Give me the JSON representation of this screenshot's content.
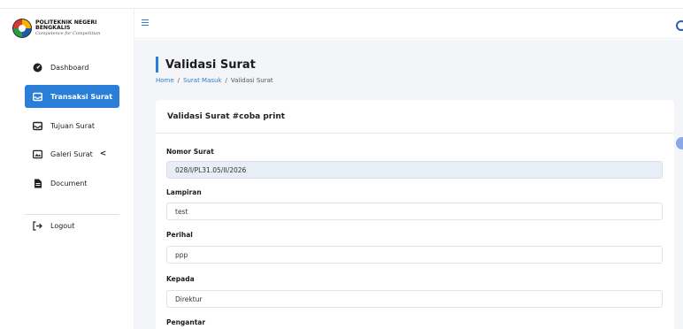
{
  "brand": {
    "title": "POLITEKNIK NEGERI BENGKALIS",
    "subtitle": "Competence for Competition"
  },
  "sidebar": {
    "items": [
      {
        "label": "Dashboard",
        "icon": "dashboard-icon"
      },
      {
        "label": "Transaksi Surat",
        "icon": "envelope-icon",
        "active": true
      },
      {
        "label": "Tujuan Surat",
        "icon": "envelope-icon"
      },
      {
        "label": "Galeri Surat",
        "icon": "gallery-icon",
        "chevron": "<"
      },
      {
        "label": "Document",
        "icon": "document-icon"
      },
      {
        "label": "Logout",
        "icon": "logout-icon"
      }
    ]
  },
  "header": {
    "menu_icon": "hamburger-icon",
    "user_icon": "user-circle-icon"
  },
  "main": {
    "title": "Validasi Surat",
    "breadcrumb": [
      "Home",
      "Surat Masuk",
      "Validasi Surat"
    ],
    "card_title": "Validasi Surat #coba print",
    "fields": [
      {
        "label": "Nomor Surat",
        "value": "028/I/PL31.05/II/2026",
        "readonly": true
      },
      {
        "label": "Lampiran",
        "value": "test"
      },
      {
        "label": "Perihal",
        "value": "ppp"
      },
      {
        "label": "Kepada",
        "value": "Direktur"
      },
      {
        "label": "Pengantar",
        "value": ""
      }
    ]
  },
  "colors": {
    "accent": "#2a7ed8",
    "background": "#f3f5f8",
    "readonly_bg": "#e8eef7"
  }
}
